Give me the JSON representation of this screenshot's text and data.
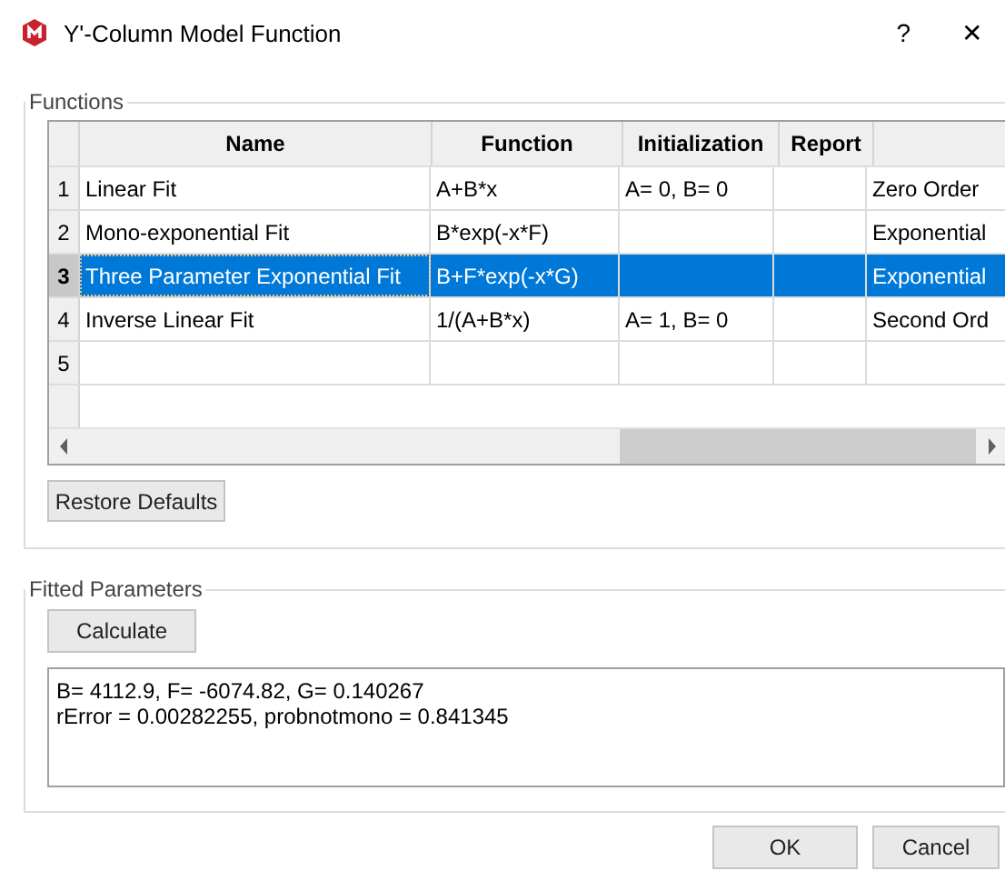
{
  "window": {
    "title": "Y'-Column Model Function",
    "help": "?",
    "close": "✕"
  },
  "functions": {
    "title": "Functions",
    "table": {
      "columns": [
        "Name",
        "Function",
        "Initialization",
        "Report"
      ],
      "rows": [
        {
          "number": "1",
          "name": "Linear Fit",
          "function": "A+B*x",
          "initialization": "A= 0, B= 0",
          "report": "",
          "column_5": "Zero Order",
          "selected": false
        },
        {
          "number": "2",
          "name": "Mono-exponential Fit",
          "function": "B*exp(-x*F)",
          "initialization": "",
          "report": "",
          "column_5": "Exponential",
          "selected": false
        },
        {
          "number": "3",
          "name": "Three Parameter Exponential Fit",
          "function": "B+F*exp(-x*G)",
          "initialization": "",
          "report": "",
          "column_5": "Exponential",
          "selected": true
        },
        {
          "number": "4",
          "name": "Inverse Linear Fit",
          "function": "1/(A+B*x)",
          "initialization": "A= 1, B= 0",
          "report": "",
          "column_5": "Second Ord",
          "selected": false
        },
        {
          "number": "5",
          "name": "",
          "function": "",
          "initialization": "",
          "report": "",
          "column_5": "",
          "selected": false
        }
      ]
    },
    "restore_button": "Restore Defaults"
  },
  "fitted": {
    "title": "Fitted Parameters",
    "calculate_button": "Calculate",
    "output": [
      "B= 4112.9, F= -6074.82, G= 0.140267",
      "rError = 0.00282255, probnotmono = 0.841345"
    ]
  },
  "buttons": [
    "OK",
    "Cancel"
  ]
}
